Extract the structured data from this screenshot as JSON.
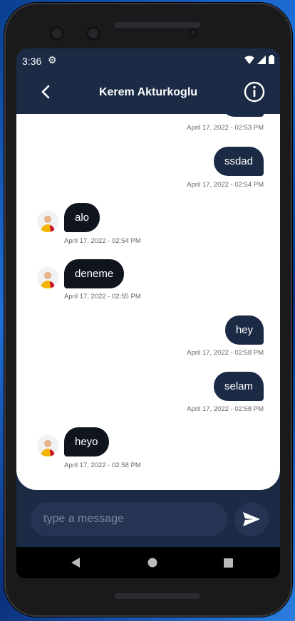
{
  "status": {
    "time": "3:36"
  },
  "header": {
    "title": "Kerem Akturkoglu"
  },
  "messages": [
    {
      "dir": "out",
      "text": "",
      "time": "April 17, 2022 - 02:53 PM"
    },
    {
      "dir": "out",
      "text": "ssdad",
      "time": "April 17, 2022 - 02:54 PM"
    },
    {
      "dir": "in",
      "text": "alo",
      "time": "April 17, 2022 - 02:54 PM"
    },
    {
      "dir": "in",
      "text": "deneme",
      "time": "April 17, 2022 - 02:55 PM"
    },
    {
      "dir": "out",
      "text": "hey",
      "time": "April 17, 2022 - 02:58 PM"
    },
    {
      "dir": "out",
      "text": "selam",
      "time": "April 17, 2022 - 02:58 PM"
    },
    {
      "dir": "in",
      "text": "heyo",
      "time": "April 17, 2022 - 02:58 PM"
    }
  ],
  "composer": {
    "placeholder": "type a message"
  },
  "colors": {
    "header_bg": "#1c2b45",
    "outgoing_bubble": "#1c2b45",
    "incoming_bubble": "#10141c"
  },
  "icons": [
    "back-arrow-icon",
    "info-icon",
    "send-icon",
    "gear-icon",
    "wifi-icon",
    "signal-icon",
    "battery-icon"
  ]
}
